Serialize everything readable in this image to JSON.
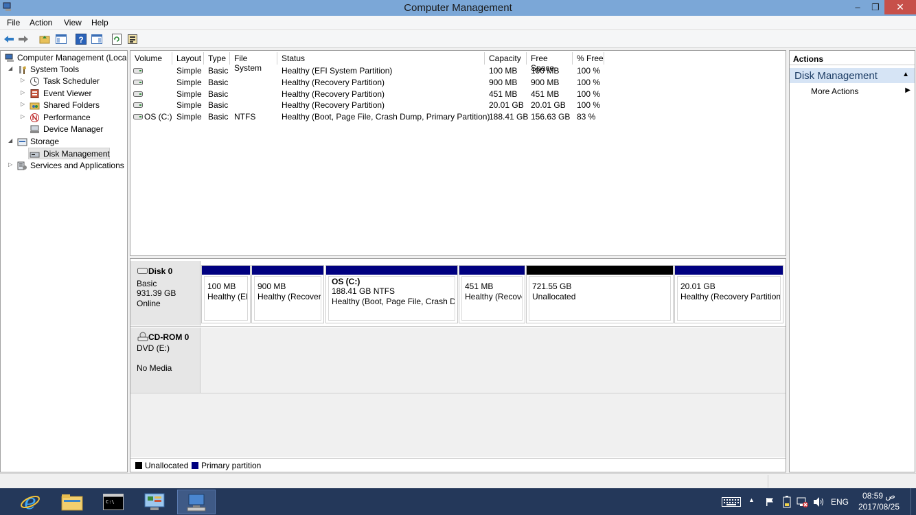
{
  "window": {
    "title": "Computer Management",
    "min_glyph": "–",
    "max_glyph": "❐",
    "close_glyph": "✕"
  },
  "menu": [
    "File",
    "Action",
    "View",
    "Help"
  ],
  "tree": {
    "root": "Computer Management (Local",
    "system_tools": "System Tools",
    "task_scheduler": "Task Scheduler",
    "event_viewer": "Event Viewer",
    "shared_folders": "Shared Folders",
    "performance": "Performance",
    "device_manager": "Device Manager",
    "storage": "Storage",
    "disk_management": "Disk Management",
    "services": "Services and Applications"
  },
  "volumes": {
    "columns": [
      "Volume",
      "Layout",
      "Type",
      "File System",
      "Status",
      "Capacity",
      "Free Space",
      "% Free"
    ],
    "rows": [
      [
        "",
        "Simple",
        "Basic",
        "",
        "Healthy (EFI System Partition)",
        "100 MB",
        "100 MB",
        "100 %"
      ],
      [
        "",
        "Simple",
        "Basic",
        "",
        "Healthy (Recovery Partition)",
        "900 MB",
        "900 MB",
        "100 %"
      ],
      [
        "",
        "Simple",
        "Basic",
        "",
        "Healthy (Recovery Partition)",
        "451 MB",
        "451 MB",
        "100 %"
      ],
      [
        "",
        "Simple",
        "Basic",
        "",
        "Healthy (Recovery Partition)",
        "20.01 GB",
        "20.01 GB",
        "100 %"
      ],
      [
        "OS (C:)",
        "Simple",
        "Basic",
        "NTFS",
        "Healthy (Boot, Page File, Crash Dump, Primary Partition)",
        "188.41 GB",
        "156.63 GB",
        "83 %"
      ]
    ]
  },
  "disk0": {
    "name": "Disk 0",
    "type": "Basic",
    "size": "931.39 GB",
    "state": "Online",
    "partitions": [
      {
        "title": "",
        "size": "100 MB",
        "status": "Healthy (EFI",
        "kind": "primary"
      },
      {
        "title": "",
        "size": "900 MB",
        "status": "Healthy (Recovery",
        "kind": "primary"
      },
      {
        "title": "OS  (C:)",
        "size": "188.41 GB NTFS",
        "status": "Healthy (Boot, Page File, Crash Dur",
        "kind": "primary"
      },
      {
        "title": "",
        "size": "451 MB",
        "status": "Healthy (Recove",
        "kind": "primary"
      },
      {
        "title": "",
        "size": "721.55 GB",
        "status": "Unallocated",
        "kind": "unallocated"
      },
      {
        "title": "",
        "size": "20.01 GB",
        "status": "Healthy (Recovery Partition)",
        "kind": "primary"
      }
    ]
  },
  "cdrom": {
    "name": "CD-ROM 0",
    "drive": "DVD (E:)",
    "media": "No Media"
  },
  "legend": {
    "unallocated": "Unallocated",
    "primary": "Primary partition"
  },
  "actions": {
    "header": "Actions",
    "section": "Disk Management",
    "more": "More Actions"
  },
  "tray": {
    "lang": "ENG",
    "time": "08:59 ص",
    "date": "2017/08/25"
  },
  "colors": {
    "primary": "#000080",
    "unallocated": "#000000",
    "accent": "#7ba7d7",
    "taskbar": "#24385a"
  }
}
